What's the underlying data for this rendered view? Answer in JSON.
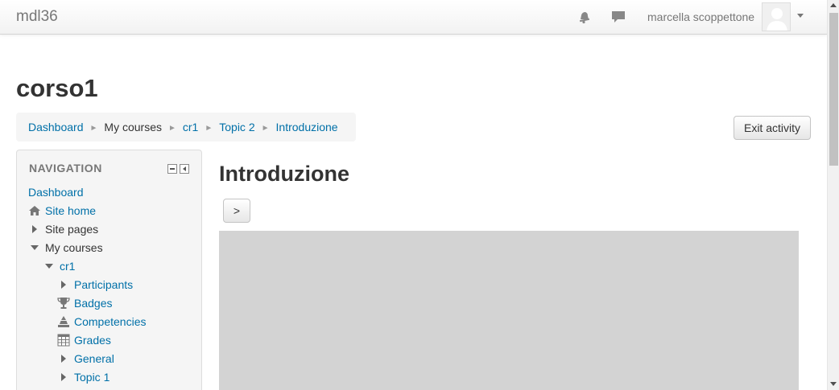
{
  "navbar": {
    "brand": "mdl36",
    "icons": [
      "notification-bell-icon",
      "messages-icon"
    ],
    "user_name": "marcella scoppettone"
  },
  "course": {
    "title": "corso1"
  },
  "breadcrumb": {
    "items": [
      {
        "label": "Dashboard",
        "link": true
      },
      {
        "label": "My courses",
        "link": false
      },
      {
        "label": "cr1",
        "link": true
      },
      {
        "label": "Topic 2",
        "link": true
      },
      {
        "label": "Introduzione",
        "link": true
      }
    ],
    "separator": "►"
  },
  "actions": {
    "exit_activity": "Exit activity"
  },
  "navigation": {
    "title": "NAVIGATION",
    "items": [
      {
        "label": "Dashboard"
      },
      {
        "label": "Site home"
      },
      {
        "label": "Site pages"
      },
      {
        "label": "My courses"
      },
      {
        "label": "cr1"
      },
      {
        "label": "Participants"
      },
      {
        "label": "Badges"
      },
      {
        "label": "Competencies"
      },
      {
        "label": "Grades"
      },
      {
        "label": "General"
      },
      {
        "label": "Topic 1"
      }
    ]
  },
  "main": {
    "heading": "Introduzione",
    "next_button": ">"
  },
  "colors": {
    "link": "#0070a8",
    "block_bg": "#f5f5f5",
    "content_frame": "#d3d3d3"
  }
}
